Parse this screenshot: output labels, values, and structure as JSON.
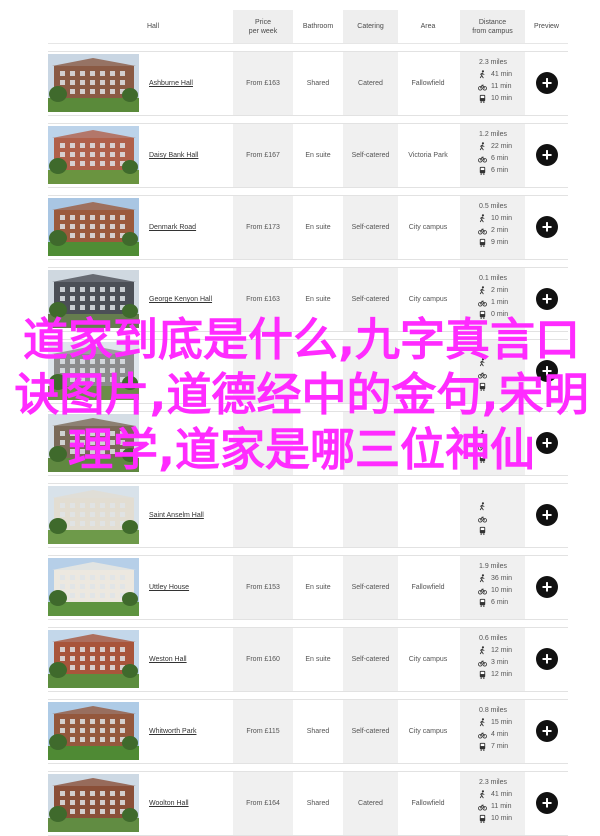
{
  "header": {
    "hall": "Hall",
    "price_line1": "Price",
    "price_line2": "per week",
    "bathroom": "Bathroom",
    "catering": "Catering",
    "area": "Area",
    "distance_line1": "Distance",
    "distance_line2": "from campus",
    "preview": "Preview"
  },
  "rows": [
    {
      "name": "Ashburne Hall",
      "price": "From £163",
      "bathroom": "Shared",
      "catering": "Catered",
      "area": "Fallowfield",
      "distance": "2.3 miles",
      "walk": "41 min",
      "cycle": "11 min",
      "bus": "10 min",
      "preview_label": "+"
    },
    {
      "name": "Daisy Bank Hall",
      "price": "From £167",
      "bathroom": "En suite",
      "catering": "Self-catered",
      "area": "Victoria Park",
      "distance": "1.2 miles",
      "walk": "22 min",
      "cycle": "6 min",
      "bus": "6 min",
      "preview_label": "+"
    },
    {
      "name": "Denmark Road",
      "price": "From £173",
      "bathroom": "En suite",
      "catering": "Self-catered",
      "area": "City campus",
      "distance": "0.5 miles",
      "walk": "10 min",
      "cycle": "2 min",
      "bus": "9 min",
      "preview_label": "+"
    },
    {
      "name": "George Kenyon Hall",
      "price": "From £163",
      "bathroom": "En suite",
      "catering": "Self-catered",
      "area": "City campus",
      "distance": "0.1 miles",
      "walk": "2 min",
      "cycle": "1 min",
      "bus": "0 min",
      "preview_label": "+"
    },
    {
      "name": "",
      "price": "",
      "bathroom": "",
      "catering": "",
      "area": "",
      "distance": "",
      "walk": "",
      "cycle": "",
      "bus": "",
      "preview_label": "+"
    },
    {
      "name": "",
      "price": "",
      "bathroom": "",
      "catering": "",
      "area": "",
      "distance": "",
      "walk": "",
      "cycle": "",
      "bus": "",
      "preview_label": "+"
    },
    {
      "name": "Saint Anselm Hall",
      "price": "",
      "bathroom": "",
      "catering": "",
      "area": "",
      "distance": "",
      "walk": "",
      "cycle": "",
      "bus": "",
      "preview_label": "+"
    },
    {
      "name": "Uttley House",
      "price": "From £153",
      "bathroom": "En suite",
      "catering": "Self-catered",
      "area": "Fallowfield",
      "distance": "1.9 miles",
      "walk": "36 min",
      "cycle": "10 min",
      "bus": "6 min",
      "preview_label": "+"
    },
    {
      "name": "Weston Hall",
      "price": "From £160",
      "bathroom": "En suite",
      "catering": "Self-catered",
      "area": "City campus",
      "distance": "0.6 miles",
      "walk": "12 min",
      "cycle": "3 min",
      "bus": "12 min",
      "preview_label": "+"
    },
    {
      "name": "Whitworth Park",
      "price": "From £115",
      "bathroom": "Shared",
      "catering": "Self-catered",
      "area": "City campus",
      "distance": "0.8 miles",
      "walk": "15 min",
      "cycle": "4 min",
      "bus": "7 min",
      "preview_label": "+"
    },
    {
      "name": "Woolton Hall",
      "price": "From £164",
      "bathroom": "Shared",
      "catering": "Catered",
      "area": "Fallowfield",
      "distance": "2.3 miles",
      "walk": "41 min",
      "cycle": "11 min",
      "bus": "10 min",
      "preview_label": "+"
    }
  ],
  "overlay_text": "道家到底是什么,九字真言口诀图片,道德经中的金句,宋明理学,道家是哪三位神仙",
  "colors": {
    "overlay": "#ff2bff",
    "shade": "#f0f0f0",
    "button": "#111111"
  }
}
